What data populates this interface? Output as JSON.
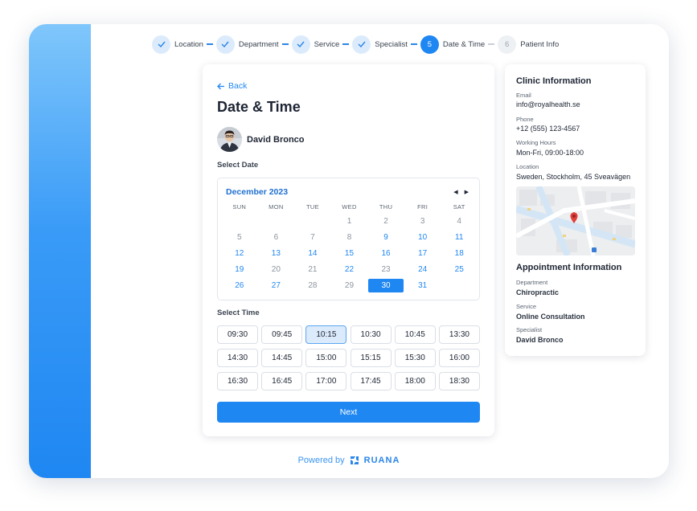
{
  "stepper": [
    {
      "label": "Location",
      "state": "done",
      "num": "1"
    },
    {
      "label": "Department",
      "state": "done",
      "num": "2"
    },
    {
      "label": "Service",
      "state": "done",
      "num": "3"
    },
    {
      "label": "Specialist",
      "state": "done",
      "num": "4"
    },
    {
      "label": "Date & Time",
      "state": "active",
      "num": "5"
    },
    {
      "label": "Patient Info",
      "state": "todo",
      "num": "6"
    }
  ],
  "booking": {
    "back_label": "Back",
    "title": "Date & Time",
    "doctor_name": "David Bronco",
    "select_date_label": "Select Date",
    "select_time_label": "Select Time",
    "next_label": "Next"
  },
  "calendar": {
    "month": "December 2023",
    "prev_icon": "◀",
    "next_icon": "▶",
    "weekdays": [
      "SUN",
      "MON",
      "TUE",
      "WED",
      "THU",
      "FRI",
      "SAT"
    ],
    "leading_blanks": 3,
    "days": [
      {
        "d": "1",
        "s": "disabled"
      },
      {
        "d": "2",
        "s": "disabled"
      },
      {
        "d": "3",
        "s": "disabled"
      },
      {
        "d": "4",
        "s": "disabled"
      },
      {
        "d": "5",
        "s": "disabled"
      },
      {
        "d": "6",
        "s": "disabled"
      },
      {
        "d": "7",
        "s": "disabled"
      },
      {
        "d": "8",
        "s": "disabled"
      },
      {
        "d": "9",
        "s": "avail"
      },
      {
        "d": "10",
        "s": "avail"
      },
      {
        "d": "11",
        "s": "avail"
      },
      {
        "d": "12",
        "s": "avail"
      },
      {
        "d": "13",
        "s": "avail"
      },
      {
        "d": "14",
        "s": "avail"
      },
      {
        "d": "15",
        "s": "avail"
      },
      {
        "d": "16",
        "s": "avail"
      },
      {
        "d": "17",
        "s": "avail"
      },
      {
        "d": "18",
        "s": "avail"
      },
      {
        "d": "19",
        "s": "avail"
      },
      {
        "d": "20",
        "s": "disabled"
      },
      {
        "d": "21",
        "s": "disabled"
      },
      {
        "d": "22",
        "s": "avail"
      },
      {
        "d": "23",
        "s": "disabled"
      },
      {
        "d": "24",
        "s": "avail"
      },
      {
        "d": "25",
        "s": "avail"
      },
      {
        "d": "26",
        "s": "avail"
      },
      {
        "d": "27",
        "s": "avail"
      },
      {
        "d": "28",
        "s": "disabled"
      },
      {
        "d": "29",
        "s": "disabled"
      },
      {
        "d": "30",
        "s": "selected"
      },
      {
        "d": "31",
        "s": "avail"
      }
    ]
  },
  "times": [
    {
      "t": "09:30"
    },
    {
      "t": "09:45"
    },
    {
      "t": "10:15",
      "selected": true
    },
    {
      "t": "10:30"
    },
    {
      "t": "10:45"
    },
    {
      "t": "13:30"
    },
    {
      "t": "14:30"
    },
    {
      "t": "14:45"
    },
    {
      "t": "15:00"
    },
    {
      "t": "15:15"
    },
    {
      "t": "15:30"
    },
    {
      "t": "16:00"
    },
    {
      "t": "16:30"
    },
    {
      "t": "16:45"
    },
    {
      "t": "17:00"
    },
    {
      "t": "17:45"
    },
    {
      "t": "18:00"
    },
    {
      "t": "18:30"
    }
  ],
  "clinic": {
    "title": "Clinic Information",
    "email_label": "Email",
    "email": "info@royalhealth.se",
    "phone_label": "Phone",
    "phone": "+12 (555) 123-4567",
    "hours_label": "Working  Hours",
    "hours": "Mon-Fri, 09:00-18:00",
    "location_label": "Location",
    "location": "Sweden, Stockholm, 45  Sveavägen"
  },
  "appointment": {
    "title": "Appointment Information",
    "department_label": "Department",
    "department": "Chiropractic",
    "service_label": "Service",
    "service": "Online Consultation",
    "specialist_label": "Specialist",
    "specialist": "David Bronco"
  },
  "footer": {
    "powered_by": "Powered by",
    "brand": "RUANA"
  },
  "colors": {
    "accent": "#1f87f2",
    "done_step_bg": "#dcebfb",
    "map_pin": "#e0403a"
  }
}
